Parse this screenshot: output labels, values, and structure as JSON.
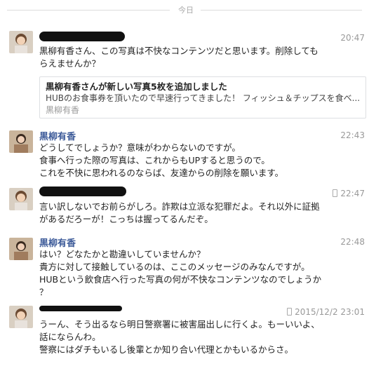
{
  "divider_label": "今日",
  "messages": [
    {
      "sender": "",
      "time": "20:47",
      "lines": [
        "黒柳有香さん、この写真は不快なコンテンツだと思います。削除しても",
        "らえませんか？"
      ],
      "share": {
        "title": "黒柳有香さんが新しい写真5枚を追加しました",
        "desc": "HUBのお食事券を頂いたので早速行ってきました！ フィッシュ＆チップスを食べ...",
        "author": "黒柳有香"
      }
    },
    {
      "sender": "黒柳有香",
      "time": "22:43",
      "lines": [
        "どうしてでしょうか？意味がわからないのですが。",
        "食事へ行った際の写真は、これからもUPすると思うので。",
        "これを不快に思われるのならば、友達からの削除を願います。"
      ]
    },
    {
      "sender": "",
      "time": "22:47",
      "lines": [
        "言い訳しないでお前らがしろ。詐欺は立派な犯罪だよ。それ以外に証拠",
        "があるだろーが！こっちは握ってるんだぞ。"
      ]
    },
    {
      "sender": "黒柳有香",
      "time": "22:48",
      "lines": [
        "はい？どなたかと勘違いしていませんか？",
        "貴方に対して接触しているのは、ここのメッセージのみなんですが。",
        "HUBという飲食店へ行った写真の何が不快なコンテンツなのでしょうか",
        "？"
      ]
    },
    {
      "sender": "",
      "time": "2015/12/2 23:01",
      "lines": [
        "うーん、そう出るなら明日警察署に被害届出しに行くよ。もーいいよ、",
        "話にならんわ。",
        "警察にはダチもいるし後輩とか知り合い代理とかもいるからさ。"
      ]
    }
  ],
  "colors": {
    "sender": "#3b5998",
    "time": "#999999",
    "redaction": "#111111"
  }
}
